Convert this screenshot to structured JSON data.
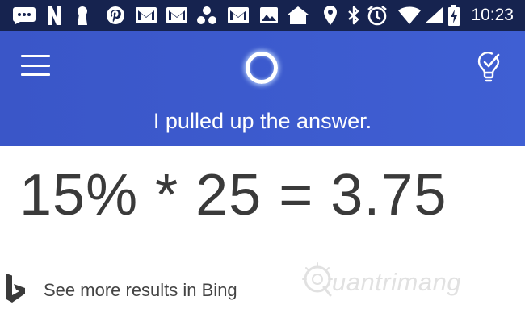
{
  "status_bar": {
    "time": "10:23",
    "left_icons": [
      "message-icon",
      "netflix-icon",
      "keyhole-icon",
      "pinterest-icon",
      "gmail-icon",
      "gmail-icon",
      "dots-icon",
      "gmail-icon",
      "image-icon",
      "home-icon"
    ],
    "right_icons": [
      "location-icon",
      "bluetooth-icon",
      "alarm-icon",
      "wifi-icon",
      "signal-icon",
      "battery-charging-icon"
    ]
  },
  "header": {
    "message": "I pulled up the answer.",
    "colors": {
      "header_bg": "#3d5bcf",
      "status_bg": "#16234f"
    }
  },
  "answer": {
    "expression": "15% * 25 = 3.75"
  },
  "bing": {
    "label": "See more results in Bing"
  },
  "watermark": {
    "text": "uantrimang"
  }
}
